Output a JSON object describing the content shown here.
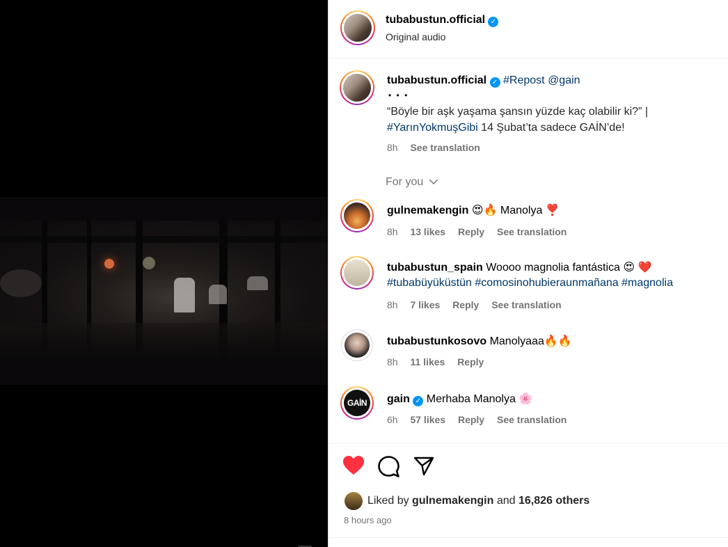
{
  "post": {
    "username": "tubabustun.official",
    "audio": "Original audio"
  },
  "caption": {
    "username": "tubabustun.official",
    "repost_tag": "#Repost",
    "repost_mention": "@gain",
    "dots": "• • •",
    "line1": "“Böyle bir aşk yaşama şansın yüzde kaç olabilir ki?” |",
    "hashtag": "#YarınYokmuşGibi",
    "line2_rest": " 14 Şubat’ta sadece GAİN’de!",
    "time": "8h",
    "see_translation": "See translation"
  },
  "filter": {
    "label": "For you"
  },
  "comments": [
    {
      "username": "gulnemakengin",
      "text": "😍🔥 Manolya ❣️",
      "time": "8h",
      "likes": "13 likes",
      "reply": "Reply",
      "translate": "See translation"
    },
    {
      "username": "tubabustun_spain",
      "text": "Woooo magnolia fantástica 😍 ❤️",
      "tags": "#tubabüyüküstün #comosinohubieraunmañana #magnolia",
      "time": "8h",
      "likes": "7 likes",
      "reply": "Reply",
      "translate": "See translation"
    },
    {
      "username": "tubabustunkosovo",
      "text": "Manolyaaa🔥🔥",
      "time": "8h",
      "likes": "11 likes",
      "reply": "Reply"
    },
    {
      "username": "gain",
      "avatar_text": "GAİN",
      "text": "Merhaba Manolya 🌸",
      "time": "6h",
      "likes": "57 likes",
      "reply": "Reply",
      "translate": "See translation"
    }
  ],
  "likes": {
    "prefix": "Liked by ",
    "user": "gulnemakengin",
    "and": " and ",
    "others": "16,826 others",
    "posted": "8 hours ago"
  },
  "colors": {
    "like": "#ff3040",
    "verified": "#0095f6",
    "link": "#00376b",
    "muted": "#737373"
  },
  "icons": [
    "heart-icon",
    "comment-icon",
    "share-icon",
    "chevron-down-icon",
    "verified-icon"
  ]
}
